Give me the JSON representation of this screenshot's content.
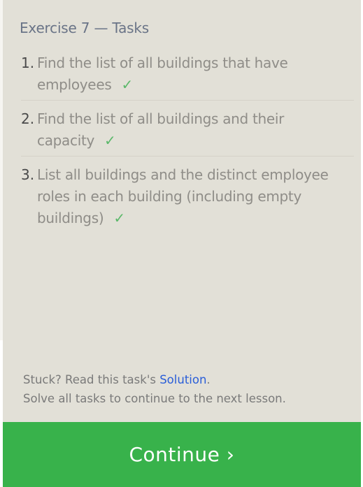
{
  "header": {
    "title": "Exercise 7 — Tasks"
  },
  "tasks": [
    {
      "number": "1.",
      "text": "Find the list of all buildings that have employees",
      "check": "✓"
    },
    {
      "number": "2.",
      "text": "Find the list of all buildings and their capacity",
      "check": "✓"
    },
    {
      "number": "3.",
      "text": "List all buildings and the distinct employee roles in each building (including empty buildings)",
      "check": "✓"
    }
  ],
  "footer": {
    "stuck_prefix": "Stuck? Read this task's ",
    "solution_link": "Solution",
    "stuck_suffix": ".",
    "note": "Solve all tasks to continue to the next lesson."
  },
  "continue_button": {
    "label": "Continue ›"
  },
  "colors": {
    "panel_bg": "#e2e0d7",
    "accent_green": "#38b24b",
    "check_green": "#5bb86a",
    "link_blue": "#2a5ed8"
  }
}
